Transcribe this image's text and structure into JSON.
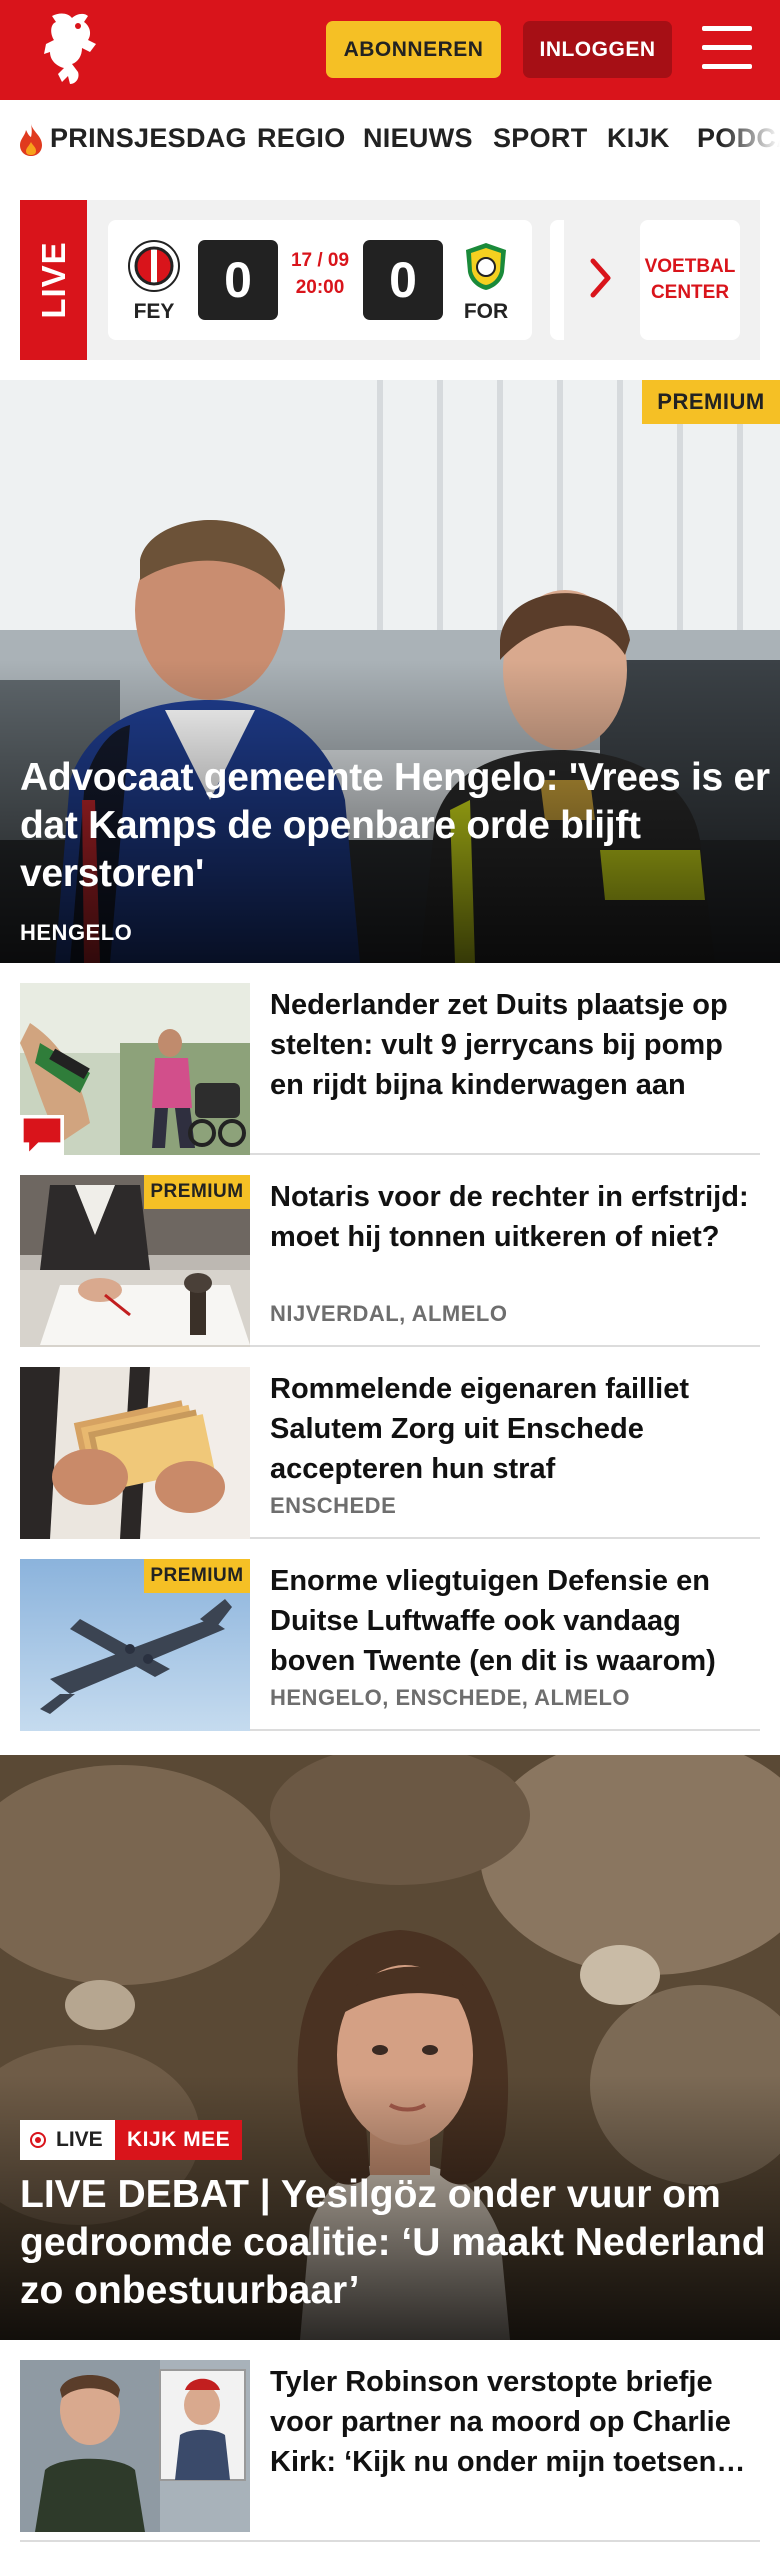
{
  "header": {
    "subscribe_label": "ABONNEREN",
    "login_label": "INLOGGEN",
    "brand_color": "#d9141b"
  },
  "nav": {
    "items": [
      "PRINSJESDAG",
      "REGIO",
      "NIEUWS",
      "SPORT",
      "KIJK",
      "PODCAST"
    ]
  },
  "live": {
    "label": "LIVE",
    "match": {
      "home_code": "FEY",
      "home_score": "0",
      "away_code": "FOR",
      "away_score": "0",
      "date": "17 / 09",
      "time": "20:00"
    },
    "voetbal_center_label": "VOETBAL CENTER"
  },
  "hero": {
    "premium_label": "PREMIUM",
    "title": "Advocaat gemeente Hengelo: 'Vrees is er dat Kamps de openbare orde blijft verstoren'",
    "location": "HENGELO"
  },
  "articles": [
    {
      "title": "Nederlander zet Duits plaatsje op stelten: vult 9 jerrycans bij pomp en rijdt bijna kinderwagen aan",
      "location": "",
      "premium": false,
      "comment_icon": "chat-bubble-icon"
    },
    {
      "title": "Notaris voor de rechter in erfstrijd: moet hij tonnen uitkeren of niet?",
      "location": "NIJVERDAL, ALMELO",
      "premium": true,
      "premium_label": "PREMIUM"
    },
    {
      "title": "Rommelende eigenaren failliet Salutem Zorg uit Enschede accepteren hun straf",
      "location": "ENSCHEDE",
      "premium": false
    },
    {
      "title": "Enorme vliegtuigen Defensie en Duitse Luftwaffe ook vandaag boven Twente (en dit is waarom)",
      "location": "HENGELO, ENSCHEDE, ALMELO",
      "premium": true,
      "premium_label": "PREMIUM"
    }
  ],
  "debate": {
    "live_label": "LIVE",
    "kijk_label": "KIJK MEE",
    "title": "LIVE DEBAT | Yesilgöz onder vuur om gedroomde coalitie: ‘U maakt Nederland zo onbestuurbaar’"
  },
  "bottom_article": {
    "title": "Tyler Robinson verstopte briefje voor partner na moord op Charlie Kirk: ‘Kijk nu onder mijn toetsen…"
  }
}
